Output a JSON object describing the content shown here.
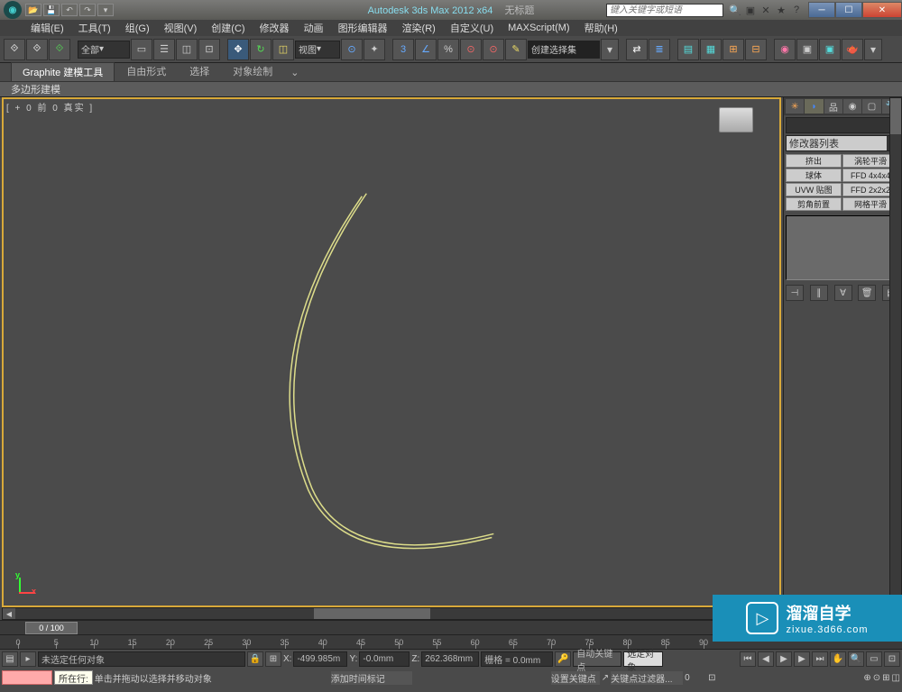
{
  "title": {
    "app": "Autodesk 3ds Max  2012  x64",
    "doc": "无标题"
  },
  "search_placeholder": "键入关键字或短语",
  "menu": [
    "编辑(E)",
    "工具(T)",
    "组(G)",
    "视图(V)",
    "创建(C)",
    "修改器",
    "动画",
    "图形编辑器",
    "渲染(R)",
    "自定义(U)",
    "MAXScript(M)",
    "帮助(H)"
  ],
  "toolbar": {
    "all_filter": "全部",
    "view_label": "视图",
    "named_sel": "创建选择集"
  },
  "ribbon": {
    "tabs": [
      "Graphite 建模工具",
      "自由形式",
      "选择",
      "对象绘制"
    ],
    "panel": "多边形建模"
  },
  "viewport": {
    "label": "[ + 0 前 0 真实 ]"
  },
  "rpanel": {
    "modifier_list": "修改器列表",
    "buttons": [
      "挤出",
      "涡轮平滑",
      "球体",
      "FFD 4x4x4",
      "UVW 贴图",
      "FFD 2x2x2",
      "剪角前置",
      "网格平滑"
    ]
  },
  "timeline": {
    "frame": "0 / 100",
    "ticks": [
      0,
      5,
      10,
      15,
      20,
      25,
      30,
      35,
      40,
      45,
      50,
      55,
      60,
      65,
      70,
      75,
      80,
      85,
      90
    ]
  },
  "status": {
    "no_selection": "未选定任何对象",
    "x": "X:",
    "xv": "-499.985m",
    "y": "Y:",
    "yv": "-0.0mm",
    "z": "Z:",
    "zv": "262.368mm",
    "grid": "栅格 = 0.0mm",
    "auto_key": "自动关键点",
    "sel_obj": "选定对象",
    "set_key": "设置关键点",
    "key_filter": "关键点过滤器...",
    "location": "所在行:",
    "hint": "单击并拖动以选择并移动对象",
    "add_time": "添加时间标记"
  },
  "watermark": {
    "brand": "溜溜自学",
    "url": "zixue.3d66.com"
  }
}
